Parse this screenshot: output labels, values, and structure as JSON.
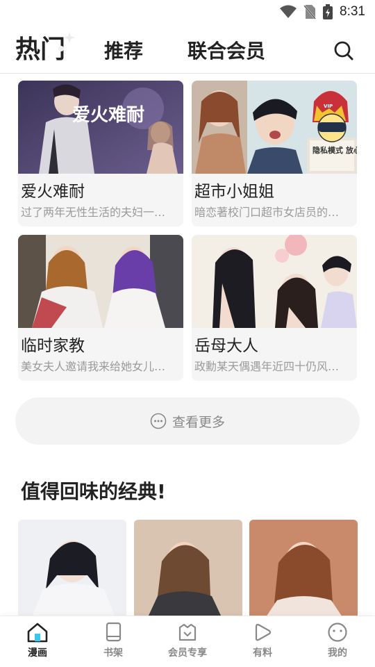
{
  "status_bar": {
    "time": "8:31"
  },
  "top_nav": {
    "tabs": [
      {
        "label": "热门",
        "active": true
      },
      {
        "label": "推荐",
        "active": false
      },
      {
        "label": "联合会员",
        "active": false
      }
    ]
  },
  "comics": [
    {
      "title": "爱火难耐",
      "desc": "过了两年无性生活的夫妇一…",
      "cover_text": "爱火难耐"
    },
    {
      "title": "超市小姐姐",
      "desc": "暗恋著校门口超市女店员的…",
      "badge_text": "隐私模式 放心看",
      "badge_tag": "VIP"
    },
    {
      "title": "临时家教",
      "desc": "美女夫人邀请我来给她女儿…"
    },
    {
      "title": "岳母大人",
      "desc": "政勳某天偶遇年近四十仍风…"
    }
  ],
  "more_button": {
    "label": "查看更多"
  },
  "section": {
    "title": "值得回味的经典!"
  },
  "bottom_nav": {
    "items": [
      {
        "label": "漫画",
        "icon": "house-icon",
        "active": true
      },
      {
        "label": "书架",
        "icon": "book-icon",
        "active": false
      },
      {
        "label": "会员专享",
        "icon": "crown-icon",
        "active": false
      },
      {
        "label": "有料",
        "icon": "play-icon",
        "active": false
      },
      {
        "label": "我的",
        "icon": "smile-icon",
        "active": false
      }
    ]
  },
  "colors": {
    "accent": "#222222",
    "muted": "#888888",
    "card_bg": "#f5f5f5"
  }
}
